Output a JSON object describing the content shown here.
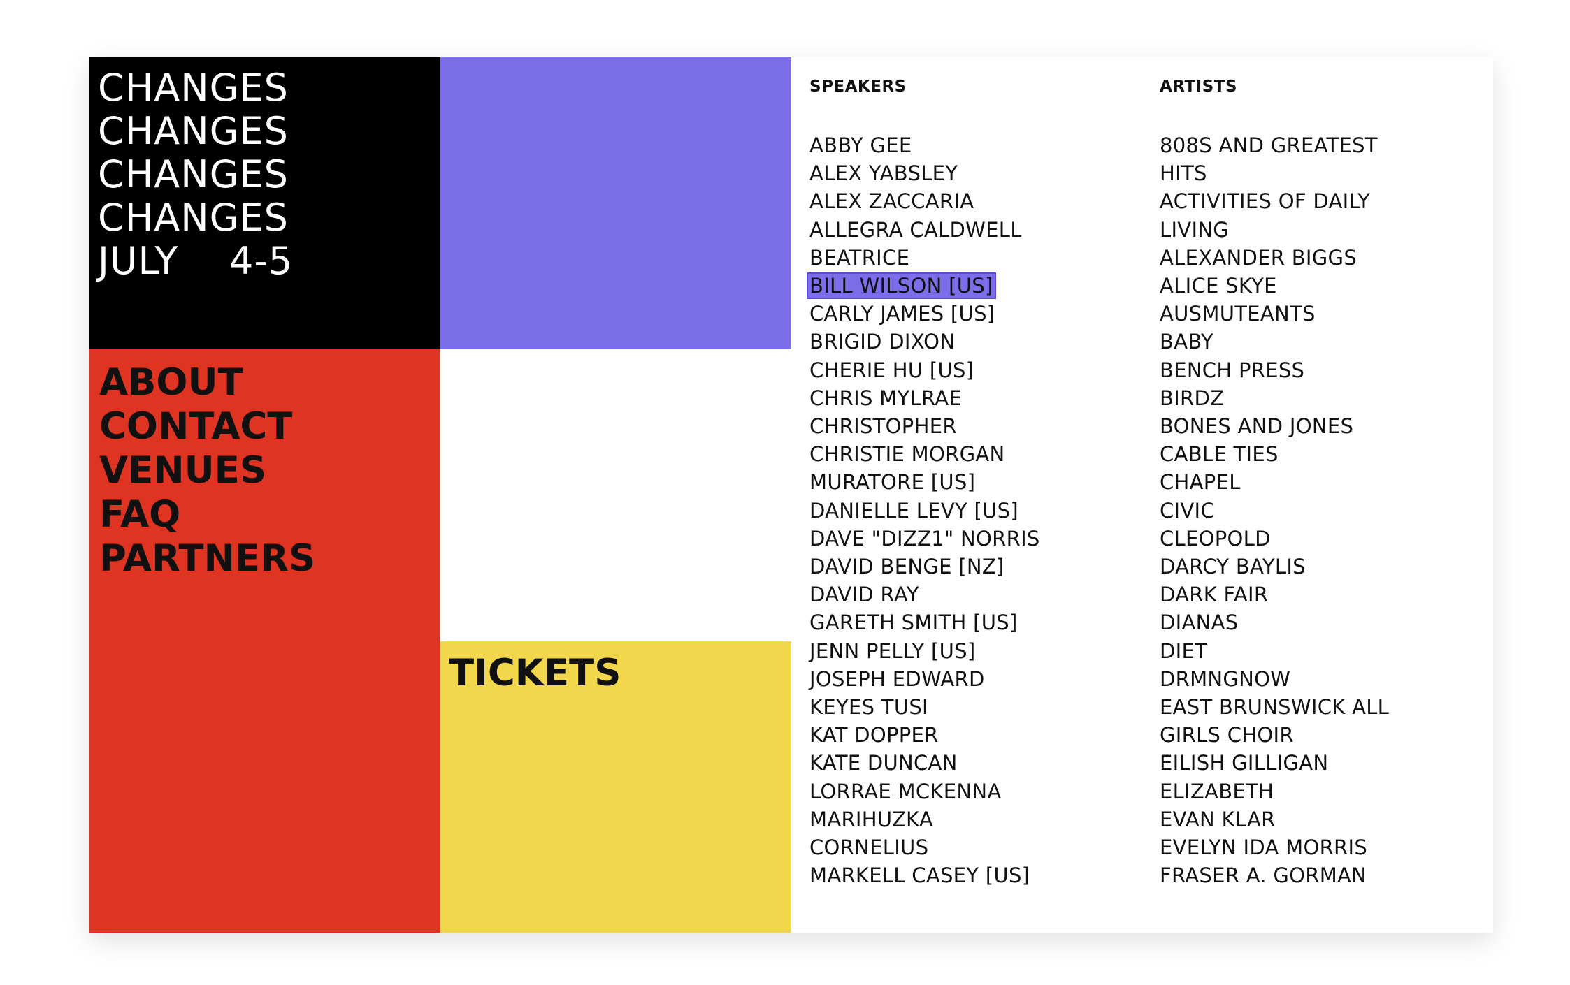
{
  "colors": {
    "black": "#000000",
    "purple": "#7b6ee8",
    "red": "#df3421",
    "yellow": "#f2d64b",
    "white": "#ffffff"
  },
  "header": {
    "title_lines": [
      "CHANGES",
      "CHANGES",
      "CHANGES",
      "CHANGES",
      "JULY    4-5"
    ]
  },
  "nav": {
    "items": [
      "ABOUT",
      "CONTACT",
      "VENUES",
      "FAQ",
      "PARTNERS"
    ]
  },
  "tickets": {
    "label": "TICKETS"
  },
  "speakers": {
    "heading": "SPEAKERS",
    "highlighted_index": 5,
    "names": [
      "ABBY GEE",
      "ALEX YABSLEY",
      "ALEX ZACCARIA",
      "ALLEGRA CALDWELL",
      "BEATRICE",
      "BILL WILSON [US]",
      "CARLY JAMES [US]",
      "BRIGID DIXON",
      "CHERIE HU [US]",
      "CHRIS MYLRAE",
      "CHRISTOPHER",
      "CHRISTIE MORGAN",
      "MURATORE [US]",
      "DANIELLE LEVY [US]",
      "DAVE \"DIZZ1\" NORRIS",
      "DAVID BENGE [NZ]",
      "DAVID RAY",
      "GARETH SMITH [US]",
      "JENN PELLY [US]",
      "JOSEPH EDWARD",
      "KEYES TUSI",
      "KAT DOPPER",
      "KATE DUNCAN",
      "LORRAE MCKENNA",
      "MARIHUZKA",
      "CORNELIUS",
      "MARKELL CASEY [US]"
    ]
  },
  "artists": {
    "heading": "ARTISTS",
    "names": [
      "808S AND GREATEST",
      "HITS",
      "ACTIVITIES OF DAILY",
      "LIVING",
      "ALEXANDER BIGGS",
      "ALICE SKYE",
      "AUSMUTEANTS",
      "BABY",
      "BENCH PRESS",
      "BIRDZ",
      "BONES AND JONES",
      "CABLE TIES",
      "CHAPEL",
      "CIVIC",
      "CLEOPOLD",
      "DARCY BAYLIS",
      "DARK FAIR",
      "DIANAS",
      "DIET",
      "DRMNGNOW",
      "EAST BRUNSWICK ALL",
      "GIRLS CHOIR",
      "EILISH GILLIGAN",
      "ELIZABETH",
      "EVAN KLAR",
      "EVELYN IDA MORRIS",
      "FRASER A. GORMAN"
    ]
  }
}
